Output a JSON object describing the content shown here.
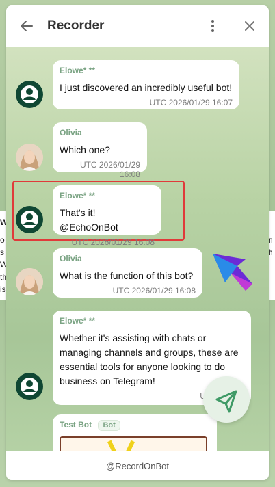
{
  "header": {
    "title": "Recorder"
  },
  "messages": [
    {
      "sender": "Elowe* **",
      "text": "I just discovered an incredibly useful bot!",
      "time": "UTC 2026/01/29 16:07"
    },
    {
      "sender": "Olivia",
      "text": "Which one?",
      "time": "UTC 2026/01/29 16:08"
    },
    {
      "sender": "Elowe* **",
      "text": "That's it! @EchoOnBot",
      "time": "UTC 2026/01/29 16:08"
    },
    {
      "sender": "Olivia",
      "text": "What is the function of this bot?",
      "time": "UTC 2026/01/29 16:08"
    },
    {
      "sender": "Elowe* **",
      "text": "Whether it's assisting with chats or managing channels and groups, these are essential tools for anyone looking to do business on Telegram!",
      "time": "UTC 2026/0"
    },
    {
      "sender": "Test Bot",
      "badge": "Bot"
    }
  ],
  "footer": {
    "label": "@RecordOnBot"
  },
  "behind": {
    "left_lines": [
      "Wh",
      "o",
      "s",
      "We",
      "th",
      "is"
    ],
    "right_lines": [
      "n",
      "h"
    ]
  },
  "colors": {
    "accent": "#7aa383",
    "user_avatar": "#0f4733",
    "highlight": "#e03a3a"
  }
}
